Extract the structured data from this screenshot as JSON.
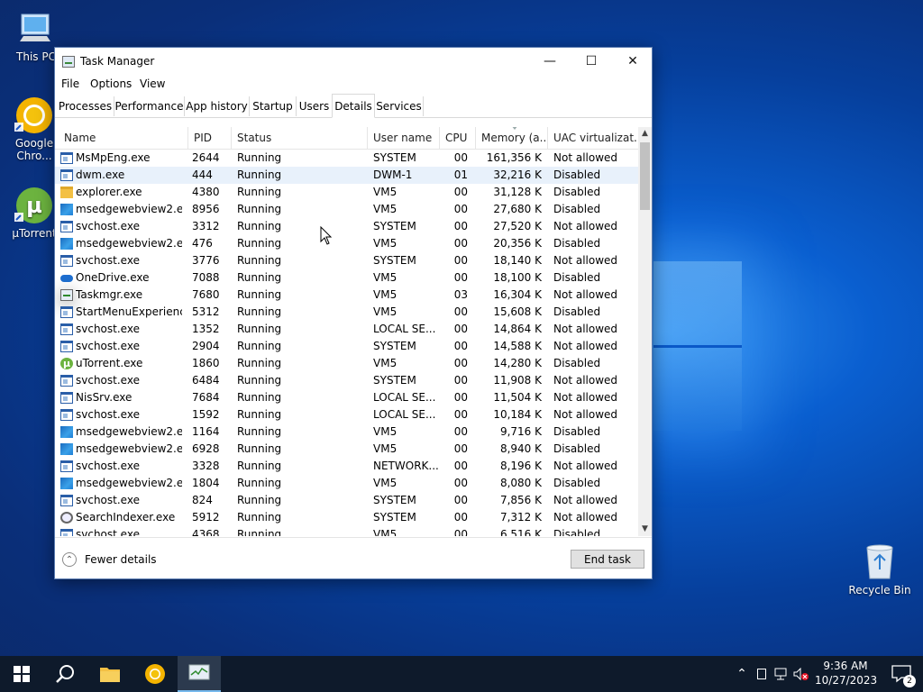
{
  "desktop": {
    "icons": [
      {
        "label": "This PC"
      },
      {
        "label": "Google Chro..."
      },
      {
        "label": "µTorrent"
      },
      {
        "label": "Recycle Bin"
      }
    ]
  },
  "window": {
    "title": "Task Manager",
    "controls": {
      "minimize": "—",
      "maximize": "☐",
      "close": "✕"
    },
    "menu": [
      "File",
      "Options",
      "View"
    ],
    "tabs": [
      "Processes",
      "Performance",
      "App history",
      "Startup",
      "Users",
      "Details",
      "Services"
    ],
    "active_tab": "Details"
  },
  "columns": [
    "Name",
    "PID",
    "Status",
    "User name",
    "CPU",
    "Memory (a...",
    "UAC virtualizat..."
  ],
  "rows": [
    {
      "icon": "app",
      "name": "MsMpEng.exe",
      "pid": "2644",
      "status": "Running",
      "user": "SYSTEM",
      "cpu": "00",
      "mem": "161,356 K",
      "uac": "Not allowed"
    },
    {
      "icon": "app",
      "name": "dwm.exe",
      "pid": "444",
      "status": "Running",
      "user": "DWM-1",
      "cpu": "01",
      "mem": "32,216 K",
      "uac": "Disabled"
    },
    {
      "icon": "folder",
      "name": "explorer.exe",
      "pid": "4380",
      "status": "Running",
      "user": "VM5",
      "cpu": "00",
      "mem": "31,128 K",
      "uac": "Disabled"
    },
    {
      "icon": "edge",
      "name": "msedgewebview2.exe",
      "pid": "8956",
      "status": "Running",
      "user": "VM5",
      "cpu": "00",
      "mem": "27,680 K",
      "uac": "Disabled"
    },
    {
      "icon": "app",
      "name": "svchost.exe",
      "pid": "3312",
      "status": "Running",
      "user": "SYSTEM",
      "cpu": "00",
      "mem": "27,520 K",
      "uac": "Not allowed"
    },
    {
      "icon": "edge",
      "name": "msedgewebview2.exe",
      "pid": "476",
      "status": "Running",
      "user": "VM5",
      "cpu": "00",
      "mem": "20,356 K",
      "uac": "Disabled"
    },
    {
      "icon": "app",
      "name": "svchost.exe",
      "pid": "3776",
      "status": "Running",
      "user": "SYSTEM",
      "cpu": "00",
      "mem": "18,140 K",
      "uac": "Not allowed"
    },
    {
      "icon": "cloud",
      "name": "OneDrive.exe",
      "pid": "7088",
      "status": "Running",
      "user": "VM5",
      "cpu": "00",
      "mem": "18,100 K",
      "uac": "Disabled"
    },
    {
      "icon": "tm",
      "name": "Taskmgr.exe",
      "pid": "7680",
      "status": "Running",
      "user": "VM5",
      "cpu": "03",
      "mem": "16,304 K",
      "uac": "Not allowed"
    },
    {
      "icon": "app",
      "name": "StartMenuExperienc...",
      "pid": "5312",
      "status": "Running",
      "user": "VM5",
      "cpu": "00",
      "mem": "15,608 K",
      "uac": "Disabled"
    },
    {
      "icon": "app",
      "name": "svchost.exe",
      "pid": "1352",
      "status": "Running",
      "user": "LOCAL SE...",
      "cpu": "00",
      "mem": "14,864 K",
      "uac": "Not allowed"
    },
    {
      "icon": "app",
      "name": "svchost.exe",
      "pid": "2904",
      "status": "Running",
      "user": "SYSTEM",
      "cpu": "00",
      "mem": "14,588 K",
      "uac": "Not allowed"
    },
    {
      "icon": "ut",
      "name": "uTorrent.exe",
      "pid": "1860",
      "status": "Running",
      "user": "VM5",
      "cpu": "00",
      "mem": "14,280 K",
      "uac": "Disabled"
    },
    {
      "icon": "app",
      "name": "svchost.exe",
      "pid": "6484",
      "status": "Running",
      "user": "SYSTEM",
      "cpu": "00",
      "mem": "11,908 K",
      "uac": "Not allowed"
    },
    {
      "icon": "app",
      "name": "NisSrv.exe",
      "pid": "7684",
      "status": "Running",
      "user": "LOCAL SE...",
      "cpu": "00",
      "mem": "11,504 K",
      "uac": "Not allowed"
    },
    {
      "icon": "app",
      "name": "svchost.exe",
      "pid": "1592",
      "status": "Running",
      "user": "LOCAL SE...",
      "cpu": "00",
      "mem": "10,184 K",
      "uac": "Not allowed"
    },
    {
      "icon": "edge",
      "name": "msedgewebview2.exe",
      "pid": "1164",
      "status": "Running",
      "user": "VM5",
      "cpu": "00",
      "mem": "9,716 K",
      "uac": "Disabled"
    },
    {
      "icon": "edge",
      "name": "msedgewebview2.exe",
      "pid": "6928",
      "status": "Running",
      "user": "VM5",
      "cpu": "00",
      "mem": "8,940 K",
      "uac": "Disabled"
    },
    {
      "icon": "app",
      "name": "svchost.exe",
      "pid": "3328",
      "status": "Running",
      "user": "NETWORK...",
      "cpu": "00",
      "mem": "8,196 K",
      "uac": "Not allowed"
    },
    {
      "icon": "edge",
      "name": "msedgewebview2.exe",
      "pid": "1804",
      "status": "Running",
      "user": "VM5",
      "cpu": "00",
      "mem": "8,080 K",
      "uac": "Disabled"
    },
    {
      "icon": "app",
      "name": "svchost.exe",
      "pid": "824",
      "status": "Running",
      "user": "SYSTEM",
      "cpu": "00",
      "mem": "7,856 K",
      "uac": "Not allowed"
    },
    {
      "icon": "search",
      "name": "SearchIndexer.exe",
      "pid": "5912",
      "status": "Running",
      "user": "SYSTEM",
      "cpu": "00",
      "mem": "7,312 K",
      "uac": "Not allowed"
    },
    {
      "icon": "app",
      "name": "svchost.exe",
      "pid": "4368",
      "status": "Running",
      "user": "VM5",
      "cpu": "00",
      "mem": "6,516 K",
      "uac": "Disabled"
    }
  ],
  "selected_row": 1,
  "footer": {
    "fewer_details": "Fewer details",
    "end_task": "End task"
  },
  "taskbar": {
    "time": "9:36 AM",
    "date": "10/27/2023",
    "notification_count": "2"
  }
}
